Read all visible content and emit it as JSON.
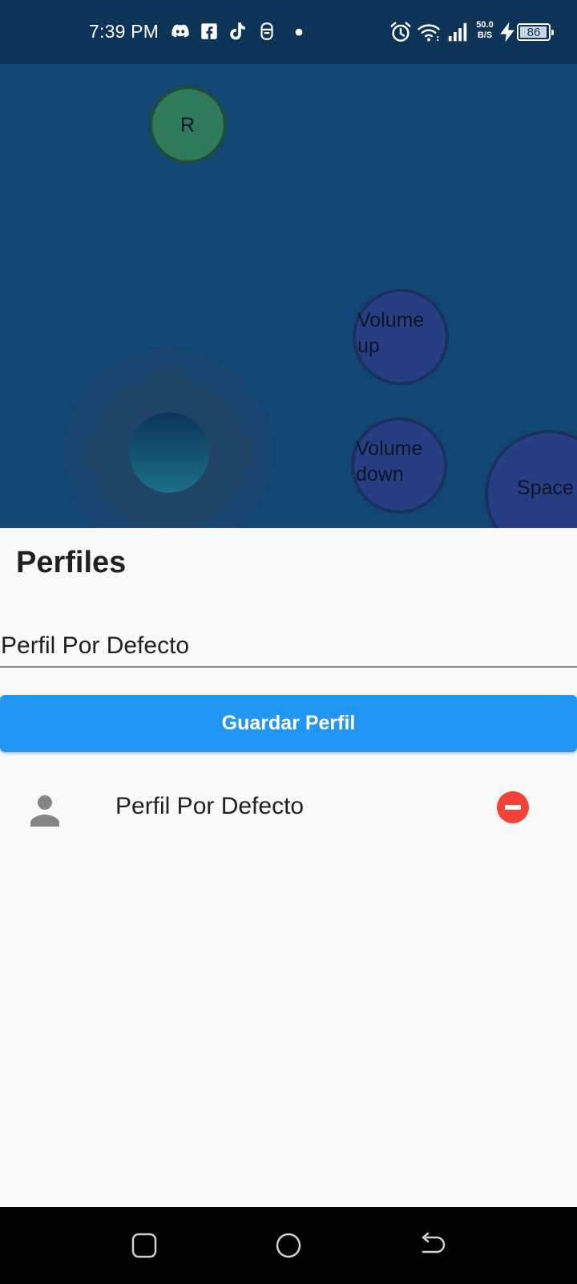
{
  "status_bar": {
    "time": "7:39 PM",
    "notification_icons": [
      "discord-icon",
      "facebook-icon",
      "tiktok-icon",
      "vpn-icon",
      "dot-icon"
    ],
    "system_icons": [
      "alarm-icon",
      "wifi-icon",
      "signal-icon",
      "charging-icon"
    ],
    "net_speed_value": "50.0",
    "net_speed_unit": "B/S",
    "battery_level": "86"
  },
  "controller": {
    "buttons": [
      {
        "label": "R"
      },
      {
        "label_line1": "Volume",
        "label_line2": "up"
      },
      {
        "label_line1": "Volume",
        "label_line2": "down"
      },
      {
        "label": "Space"
      }
    ],
    "joystick": "joystick"
  },
  "profiles": {
    "title": "Perfiles",
    "name_input_value": "Perfil Por Defecto",
    "save_label": "Guardar Perfil",
    "items": [
      {
        "label": "Perfil Por Defecto",
        "icon": "person-icon",
        "action_icon": "remove-icon"
      }
    ]
  },
  "colors": {
    "status_bar_bg": "#0d3457",
    "controller_bg": "#114674",
    "primary": "#2196f3",
    "danger": "#f44336",
    "button_green": "#2e7a5b",
    "button_blue": "#253f82"
  },
  "nav_bar": {
    "items": [
      "recent-apps-icon",
      "home-icon",
      "back-icon"
    ]
  }
}
